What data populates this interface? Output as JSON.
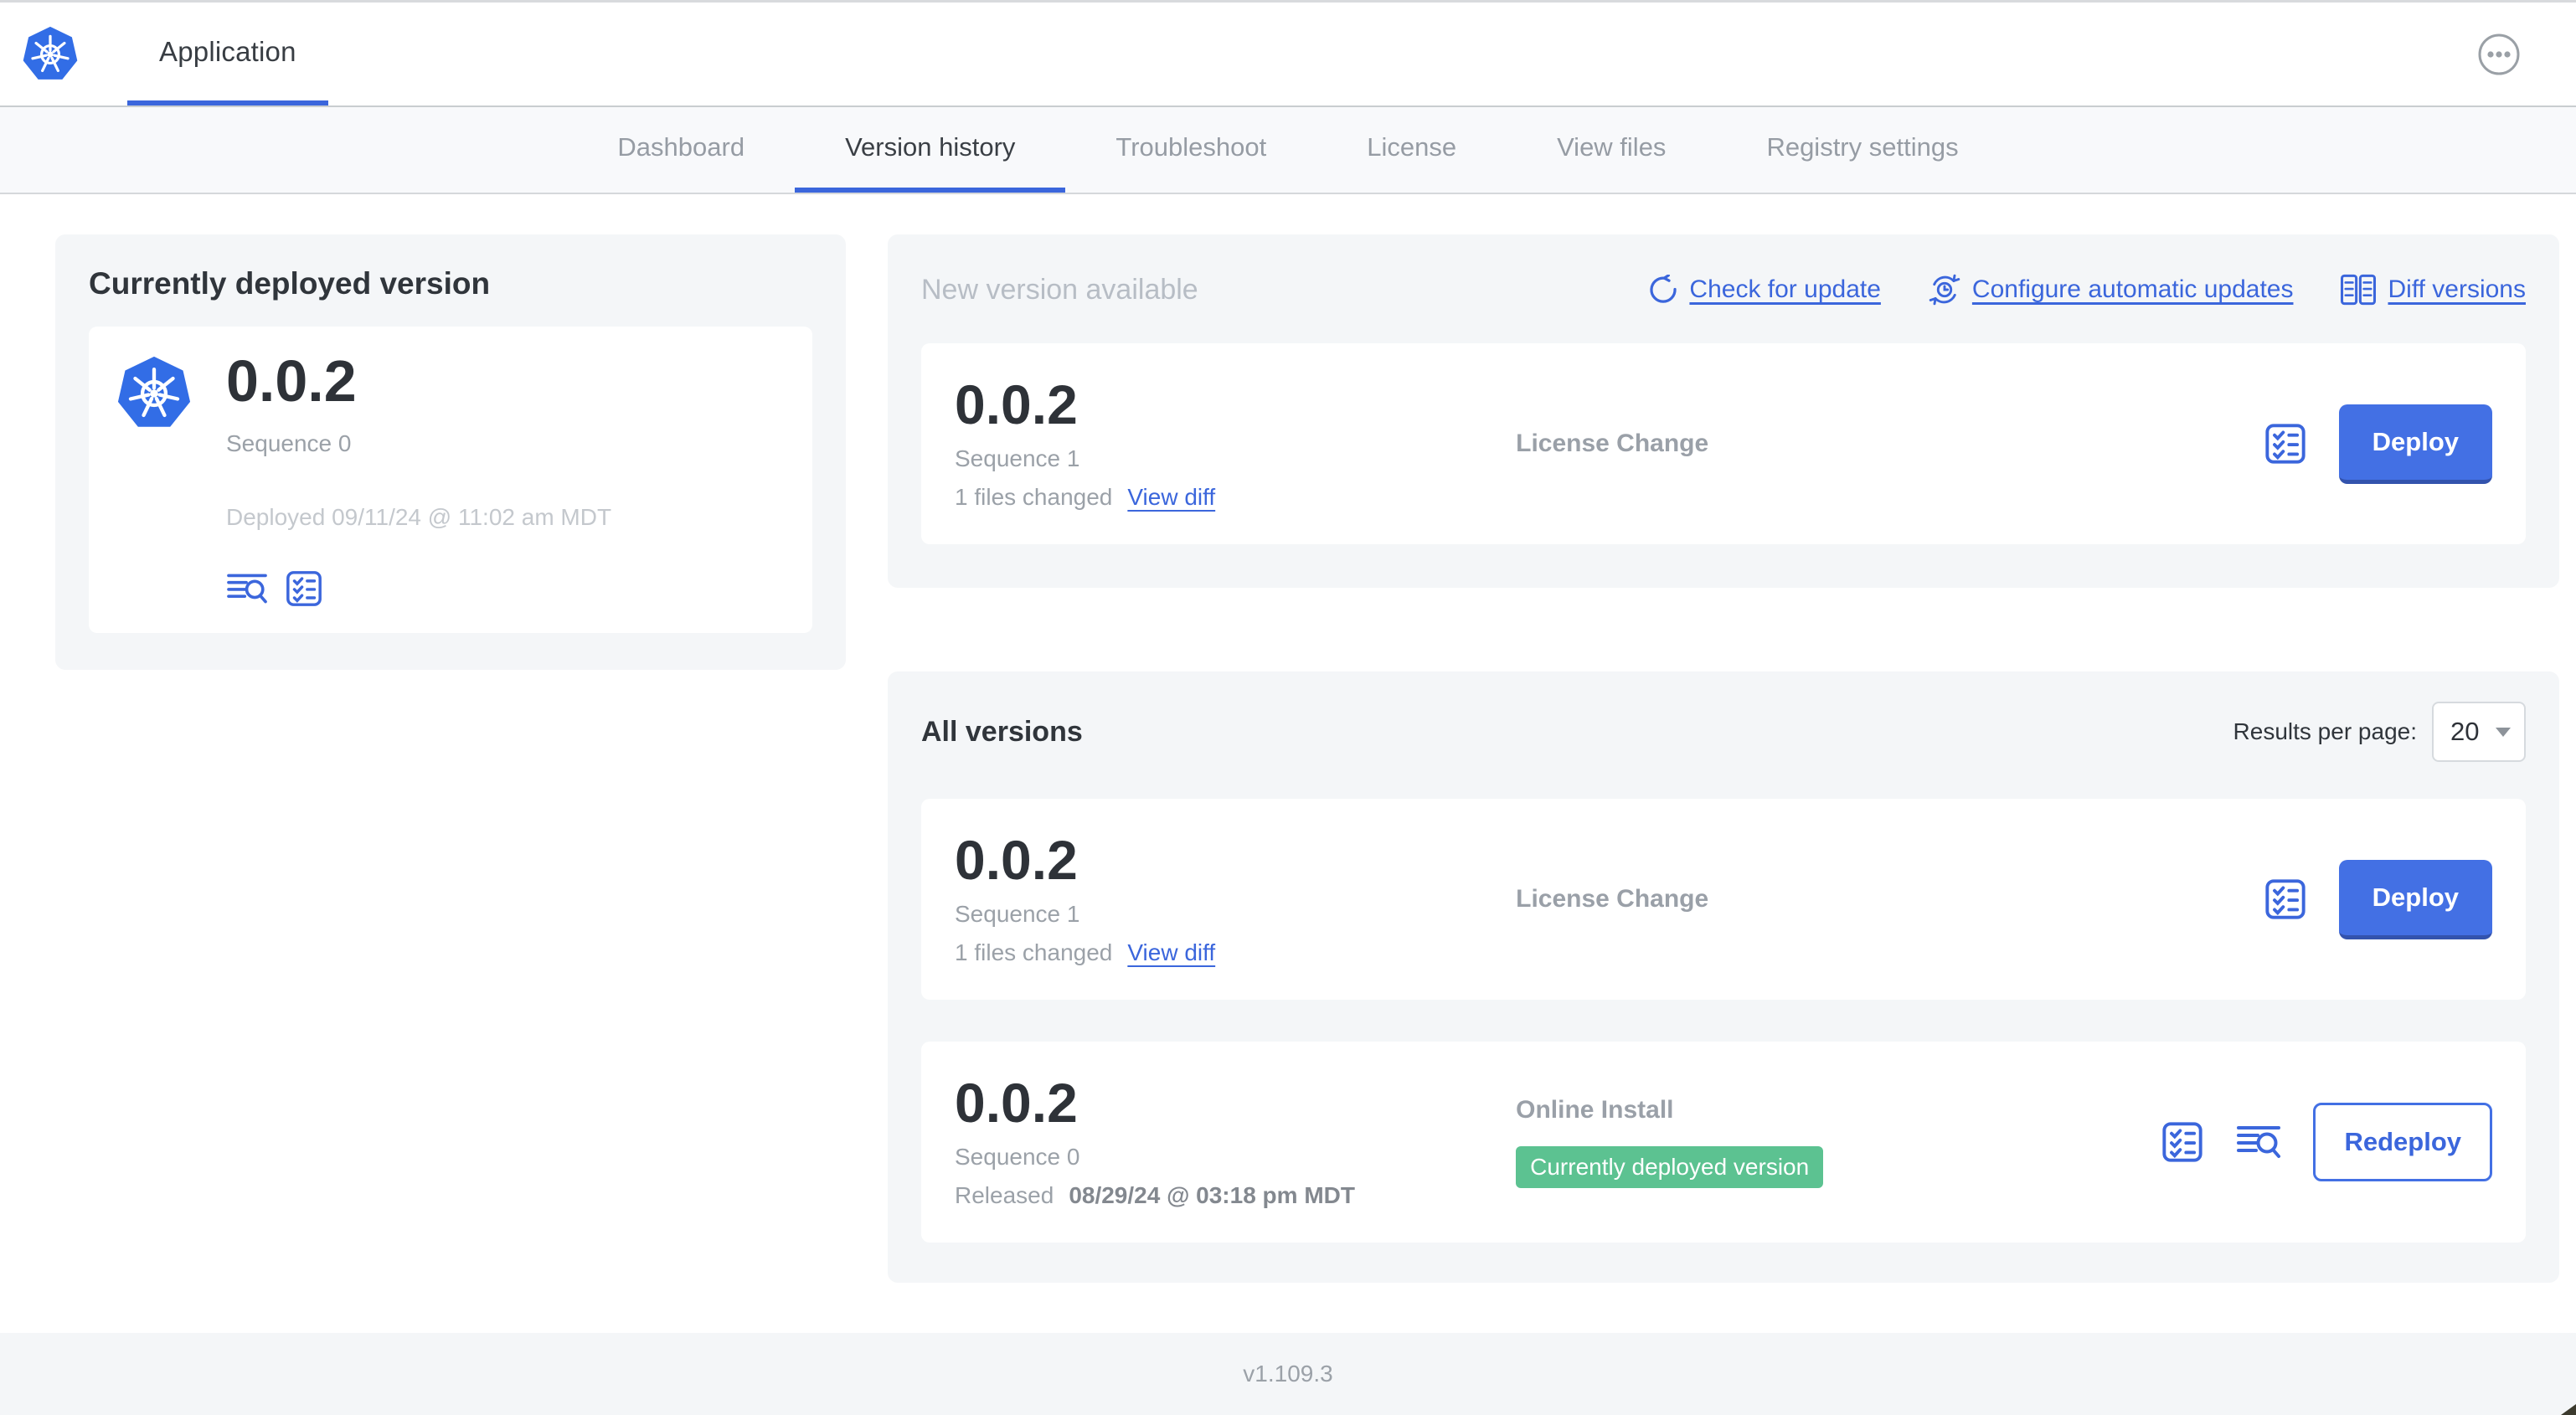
{
  "header": {
    "app_title": "Application"
  },
  "nav": {
    "items": [
      {
        "label": "Dashboard",
        "active": false
      },
      {
        "label": "Version history",
        "active": true
      },
      {
        "label": "Troubleshoot",
        "active": false
      },
      {
        "label": "License",
        "active": false
      },
      {
        "label": "View files",
        "active": false
      },
      {
        "label": "Registry settings",
        "active": false
      }
    ]
  },
  "current": {
    "title": "Currently deployed version",
    "version": "0.0.2",
    "sequence": "Sequence 0",
    "deployed": "Deployed 09/11/24 @ 11:02 am MDT"
  },
  "new_version": {
    "title": "New version available",
    "check_link": "Check for update",
    "auto_link": "Configure automatic updates",
    "diff_link": "Diff versions",
    "row": {
      "version": "0.0.2",
      "sequence": "Sequence 1",
      "files": "1 files changed",
      "view_diff": "View diff",
      "source": "License Change",
      "action": "Deploy"
    }
  },
  "all_versions": {
    "title": "All versions",
    "per_page_label": "Results per page:",
    "per_page_value": "20",
    "rows": [
      {
        "version": "0.0.2",
        "sequence": "Sequence 1",
        "files": "1 files changed",
        "view_diff": "View diff",
        "source": "License Change",
        "action": "Deploy"
      },
      {
        "version": "0.0.2",
        "sequence": "Sequence 0",
        "released_label": "Released",
        "released_date": "08/29/24 @ 03:18 pm MDT",
        "source": "Online Install",
        "badge": "Currently deployed version",
        "action": "Redeploy"
      }
    ]
  },
  "footer": {
    "app_version": "v1.109.3"
  },
  "colors": {
    "accent_blue": "#3b66dc",
    "button_blue": "#4370e4",
    "button_shadow": "#3353ad",
    "kubernetes_blue": "#326de6",
    "badge_green": "#5cc291",
    "card_gray": "#f4f6f8",
    "muted_text": "#9ba1a8"
  }
}
